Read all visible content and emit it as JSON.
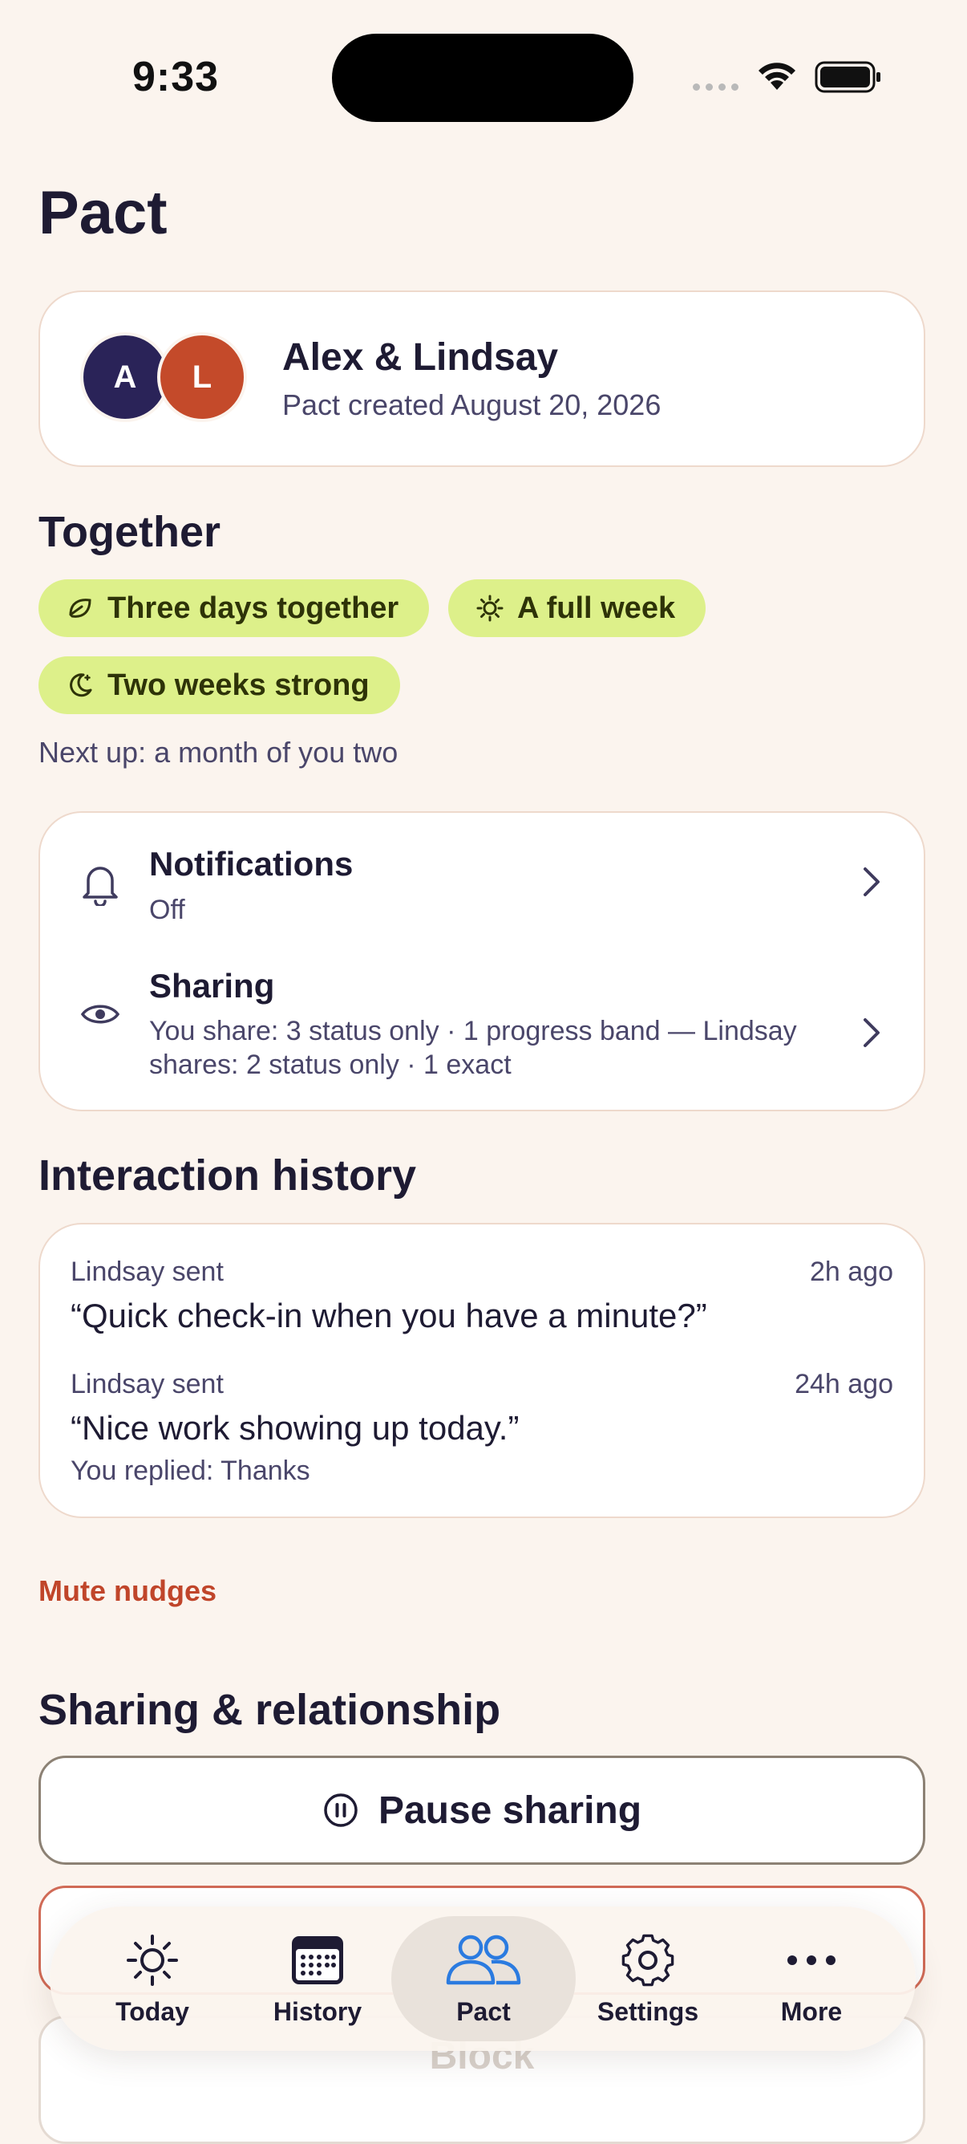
{
  "status_bar": {
    "time": "9:33"
  },
  "page": {
    "title": "Pact"
  },
  "pair": {
    "avatar_a": "A",
    "avatar_b": "L",
    "avatar_a_color": "#2A2358",
    "avatar_b_color": "#C44A2A",
    "name": "Alex & Lindsay",
    "created": "Pact created August 20, 2026"
  },
  "together": {
    "heading": "Together",
    "chips": [
      {
        "icon": "leaf-icon",
        "label": "Three days together"
      },
      {
        "icon": "sun-icon",
        "label": "A full week"
      },
      {
        "icon": "moon-icon",
        "label": "Two weeks strong"
      }
    ],
    "next_up": "Next up: a month of you two"
  },
  "settings_card": {
    "notifications": {
      "icon": "bell-icon",
      "title": "Notifications",
      "value": "Off"
    },
    "sharing": {
      "icon": "eye-icon",
      "title": "Sharing",
      "detail_line1": "You share: 3 status only · 1 progress band — Lindsay",
      "detail_line2": "shares: 2 status only · 1 exact"
    }
  },
  "interaction_history": {
    "heading": "Interaction history",
    "items": [
      {
        "meta": "Lindsay sent",
        "time": "2h ago",
        "message": "“Quick check-in when you have a minute?”",
        "reply": ""
      },
      {
        "meta": "Lindsay sent",
        "time": "24h ago",
        "message": "“Nice work showing up today.”",
        "reply": "You replied: Thanks"
      }
    ]
  },
  "mute_label": "Mute nudges",
  "relationship": {
    "heading": "Sharing & relationship",
    "pause_label": "Pause sharing",
    "block_label": "Block"
  },
  "tabs": [
    {
      "label": "Today",
      "icon": "sun-icon",
      "active": false
    },
    {
      "label": "History",
      "icon": "calendar-icon",
      "active": false
    },
    {
      "label": "Pact",
      "icon": "people-icon",
      "active": true
    },
    {
      "label": "Settings",
      "icon": "gear-icon",
      "active": false
    },
    {
      "label": "More",
      "icon": "ellipsis-icon",
      "active": false
    }
  ],
  "colors": {
    "background": "#FBF4EE",
    "chip": "#DDF08A",
    "accent_red": "#C0452A",
    "active_tab": "#2B7BE0"
  }
}
